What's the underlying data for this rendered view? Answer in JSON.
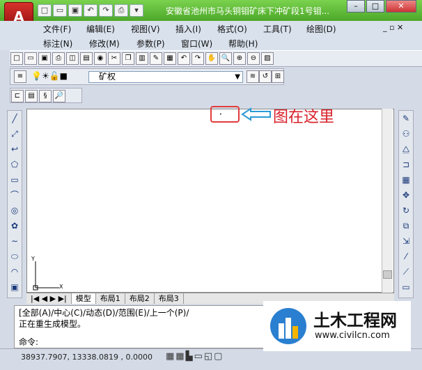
{
  "title": "安徽省池州市马头铜钼矿床下冲矿段1号钼...",
  "app_logo": "A",
  "menu_row1": [
    "文件(F)",
    "编辑(E)",
    "视图(V)",
    "插入(I)",
    "格式(O)",
    "工具(T)",
    "绘图(D)"
  ],
  "menu_row2": [
    "标注(N)",
    "修改(M)",
    "参数(P)",
    "窗口(W)",
    "帮助(H)"
  ],
  "layer": {
    "name": "矿权"
  },
  "annotation": "图在这里",
  "tabs": [
    "模型",
    "布局1",
    "布局2",
    "布局3"
  ],
  "command_lines": [
    "[全部(A)/中心(C)/动态(D)/范围(E)/上一个(P)/",
    "正在重生成模型。",
    "命令:"
  ],
  "coordinates": "38937.7907,  13338.0819 , 0.0000",
  "watermark": {
    "title": "土木工程网",
    "url": "www.civilcn.com"
  },
  "ucs": {
    "x": "X",
    "y": "Y"
  },
  "accent": "#e23a3a"
}
